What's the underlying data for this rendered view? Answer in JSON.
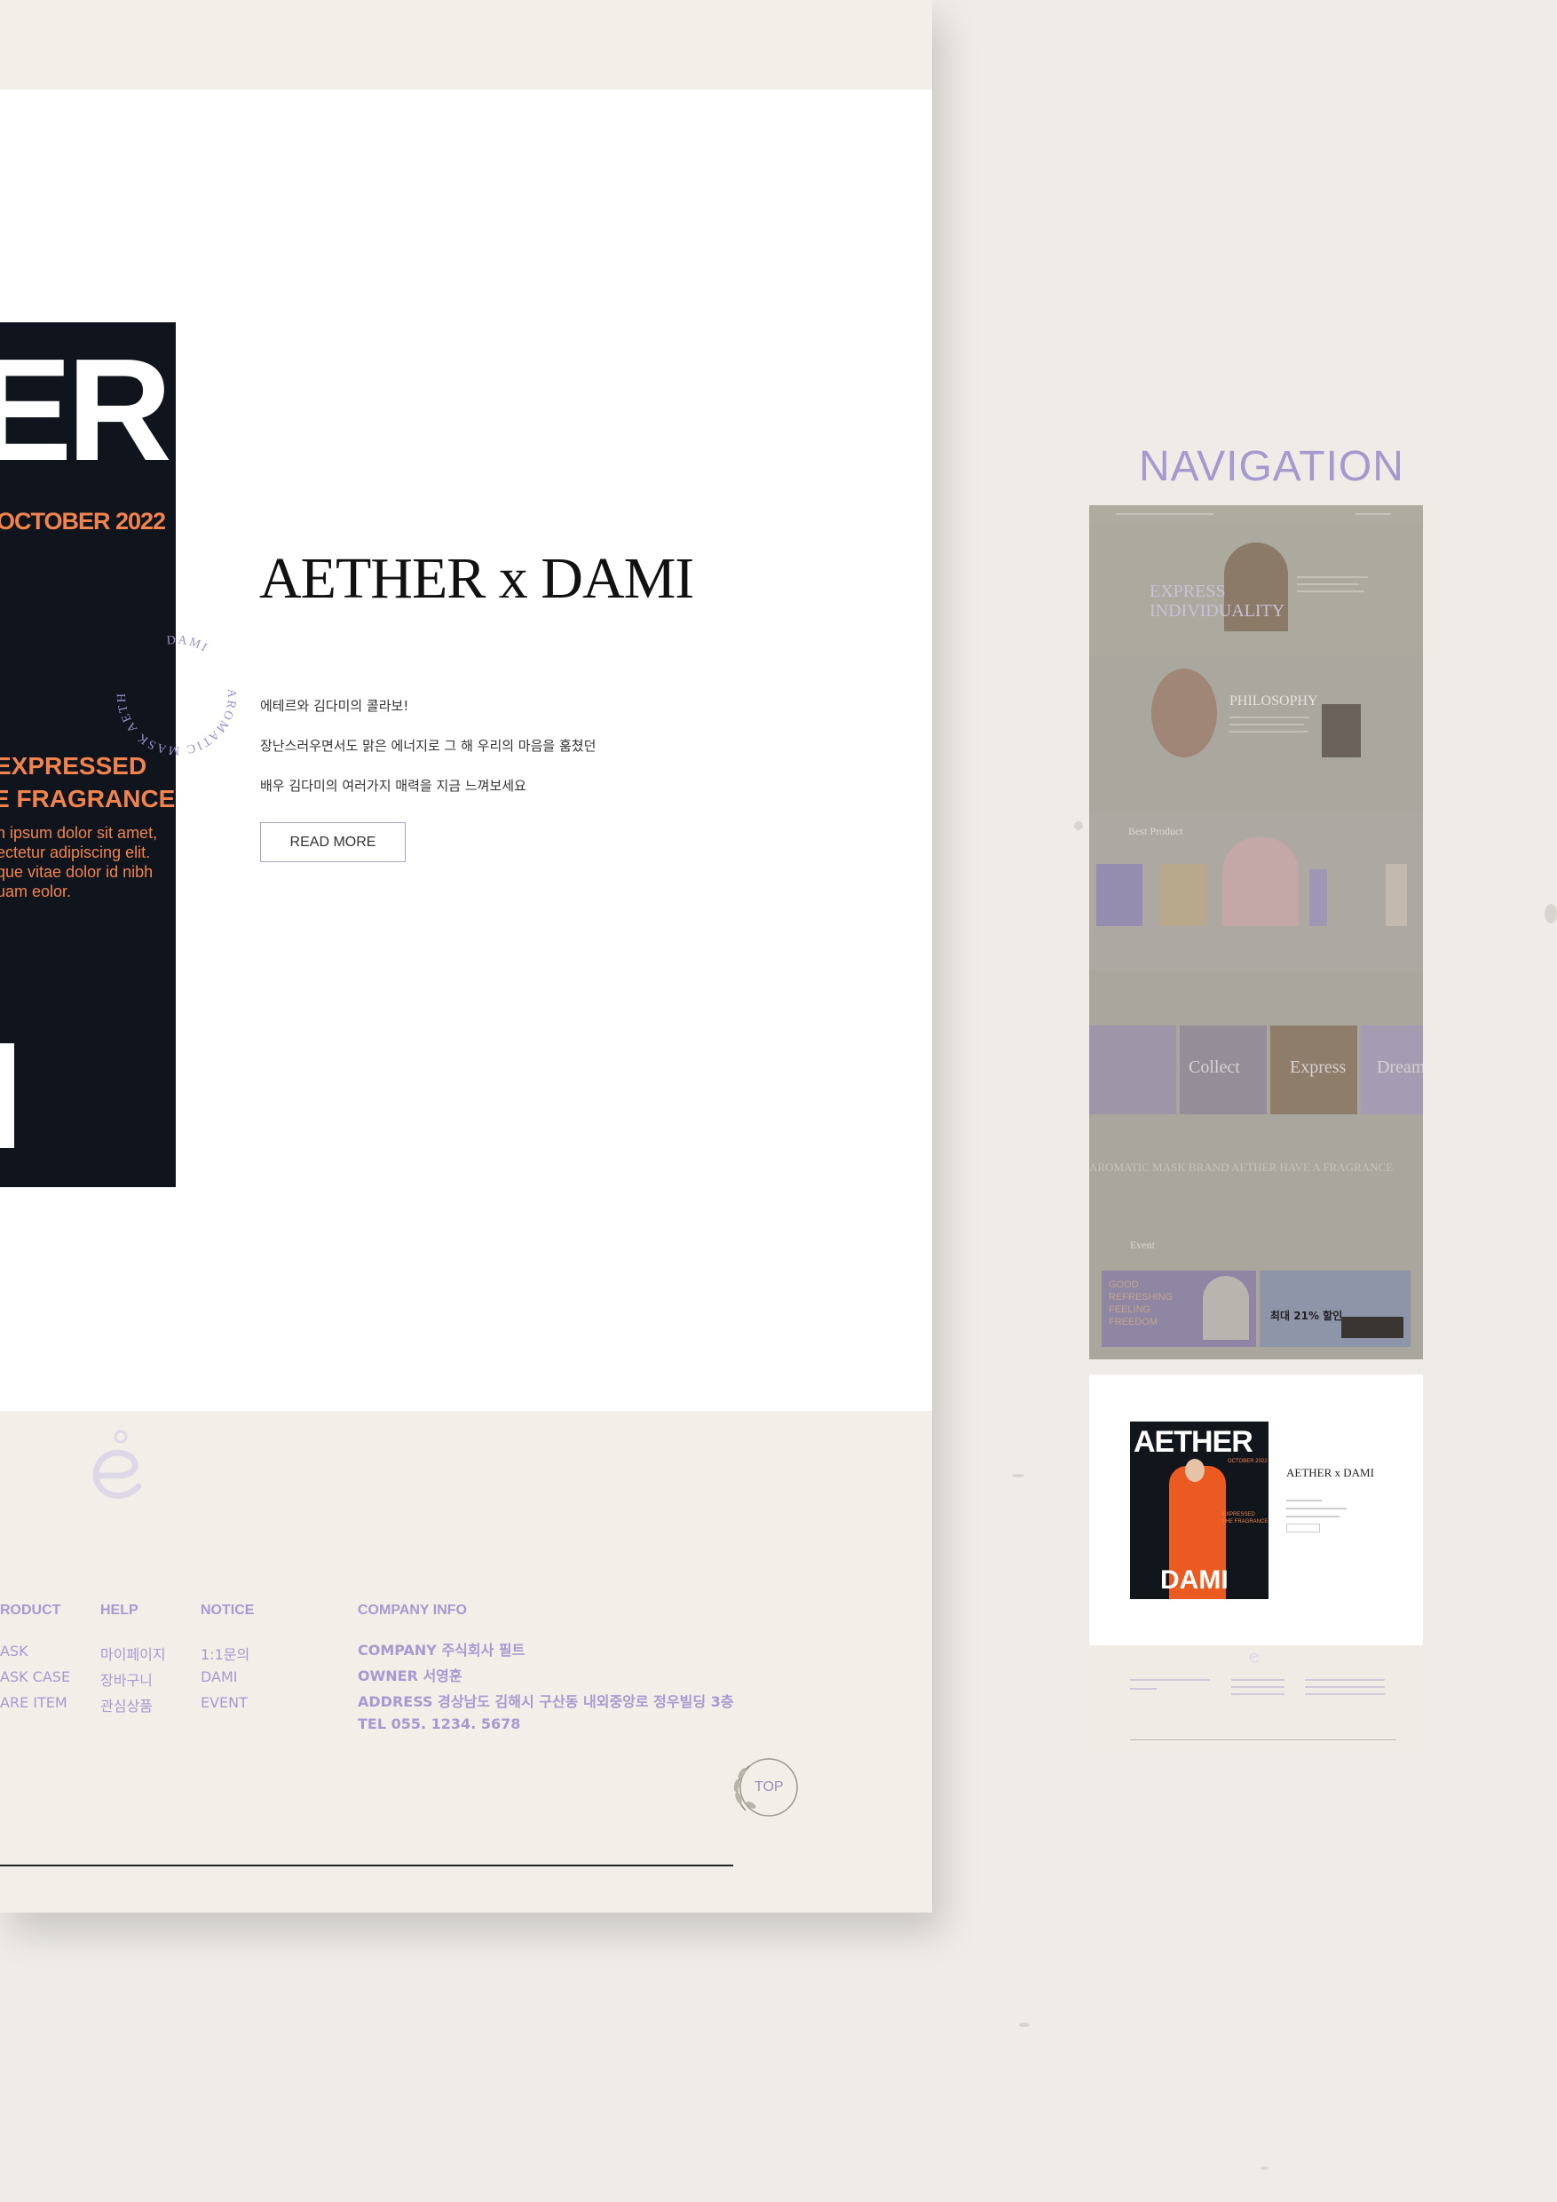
{
  "collab": {
    "poster": {
      "big_text": "ER",
      "date": "OCTOBER 2022",
      "expressed": "EXPRESSED",
      "fragrance": "E FRAGRANCE",
      "lorem": [
        "n ipsum dolor sit amet,",
        "ectetur adipiscing elit.",
        "que vitae dolor id nibh",
        "uam eolor."
      ]
    },
    "badge_text": "AROMATIC MASK AETHER",
    "badge_top": "DAMI",
    "title": "AETHER x DAMI",
    "desc": [
      "에테르와 김다미의 콜라보!",
      "장난스러우면서도 맑은 에너지로 그 해 우리의 마음을 훔쳤던",
      "배우 김다미의 여러가지 매력을 지금 느껴보세요"
    ],
    "read_more": "READ MORE"
  },
  "footer": {
    "columns": [
      {
        "head": "RODUCT",
        "links": [
          "ASK",
          "ASK CASE",
          "ARE ITEM"
        ]
      },
      {
        "head": "HELP",
        "links": [
          "마이페이지",
          "장바구니",
          "관심상품"
        ]
      },
      {
        "head": "NOTICE",
        "links": [
          "1:1문의",
          "DAMI",
          "EVENT"
        ]
      }
    ],
    "company": {
      "head": "COMPANY INFO",
      "lines": [
        "COMPANY 주식회사 필트",
        "OWNER 서영훈",
        "ADDRESS 경상남도 김해시 구산동 내외중앙로 정우빌딩 3층",
        "TEL 055. 1234. 5678"
      ]
    },
    "top_label": "TOP"
  },
  "navigation": {
    "heading": "NAVIGATION",
    "hero_text": [
      "EXPRESS",
      "INDIVIDUALITY"
    ],
    "philosophy": "PHILOSOPHY",
    "best_product": "Best Product",
    "marquee": "AROMATIC MASK BRAND  AETHER  HAVE A FRAGRANCE",
    "event": "Event",
    "event_banner": [
      "GOOD",
      "REFRESHING",
      "FEELING",
      "FREEDOM"
    ],
    "sale_text": "최대 21% 할인",
    "cards": [
      "Collect",
      "Express",
      "Dream"
    ],
    "poster_title": "AETHER",
    "poster_date": "OCTOBER 2022",
    "poster_name": "DAMI",
    "poster_copy": [
      "EXPRESSED",
      "THE FRAGRANCE"
    ],
    "mini_title": "AETHER x DAMI"
  },
  "colors": {
    "accent": "#a69ad0",
    "poster_bg": "#10141c",
    "poster_orange": "#f1834f",
    "page_bg": "#f2efe8"
  }
}
